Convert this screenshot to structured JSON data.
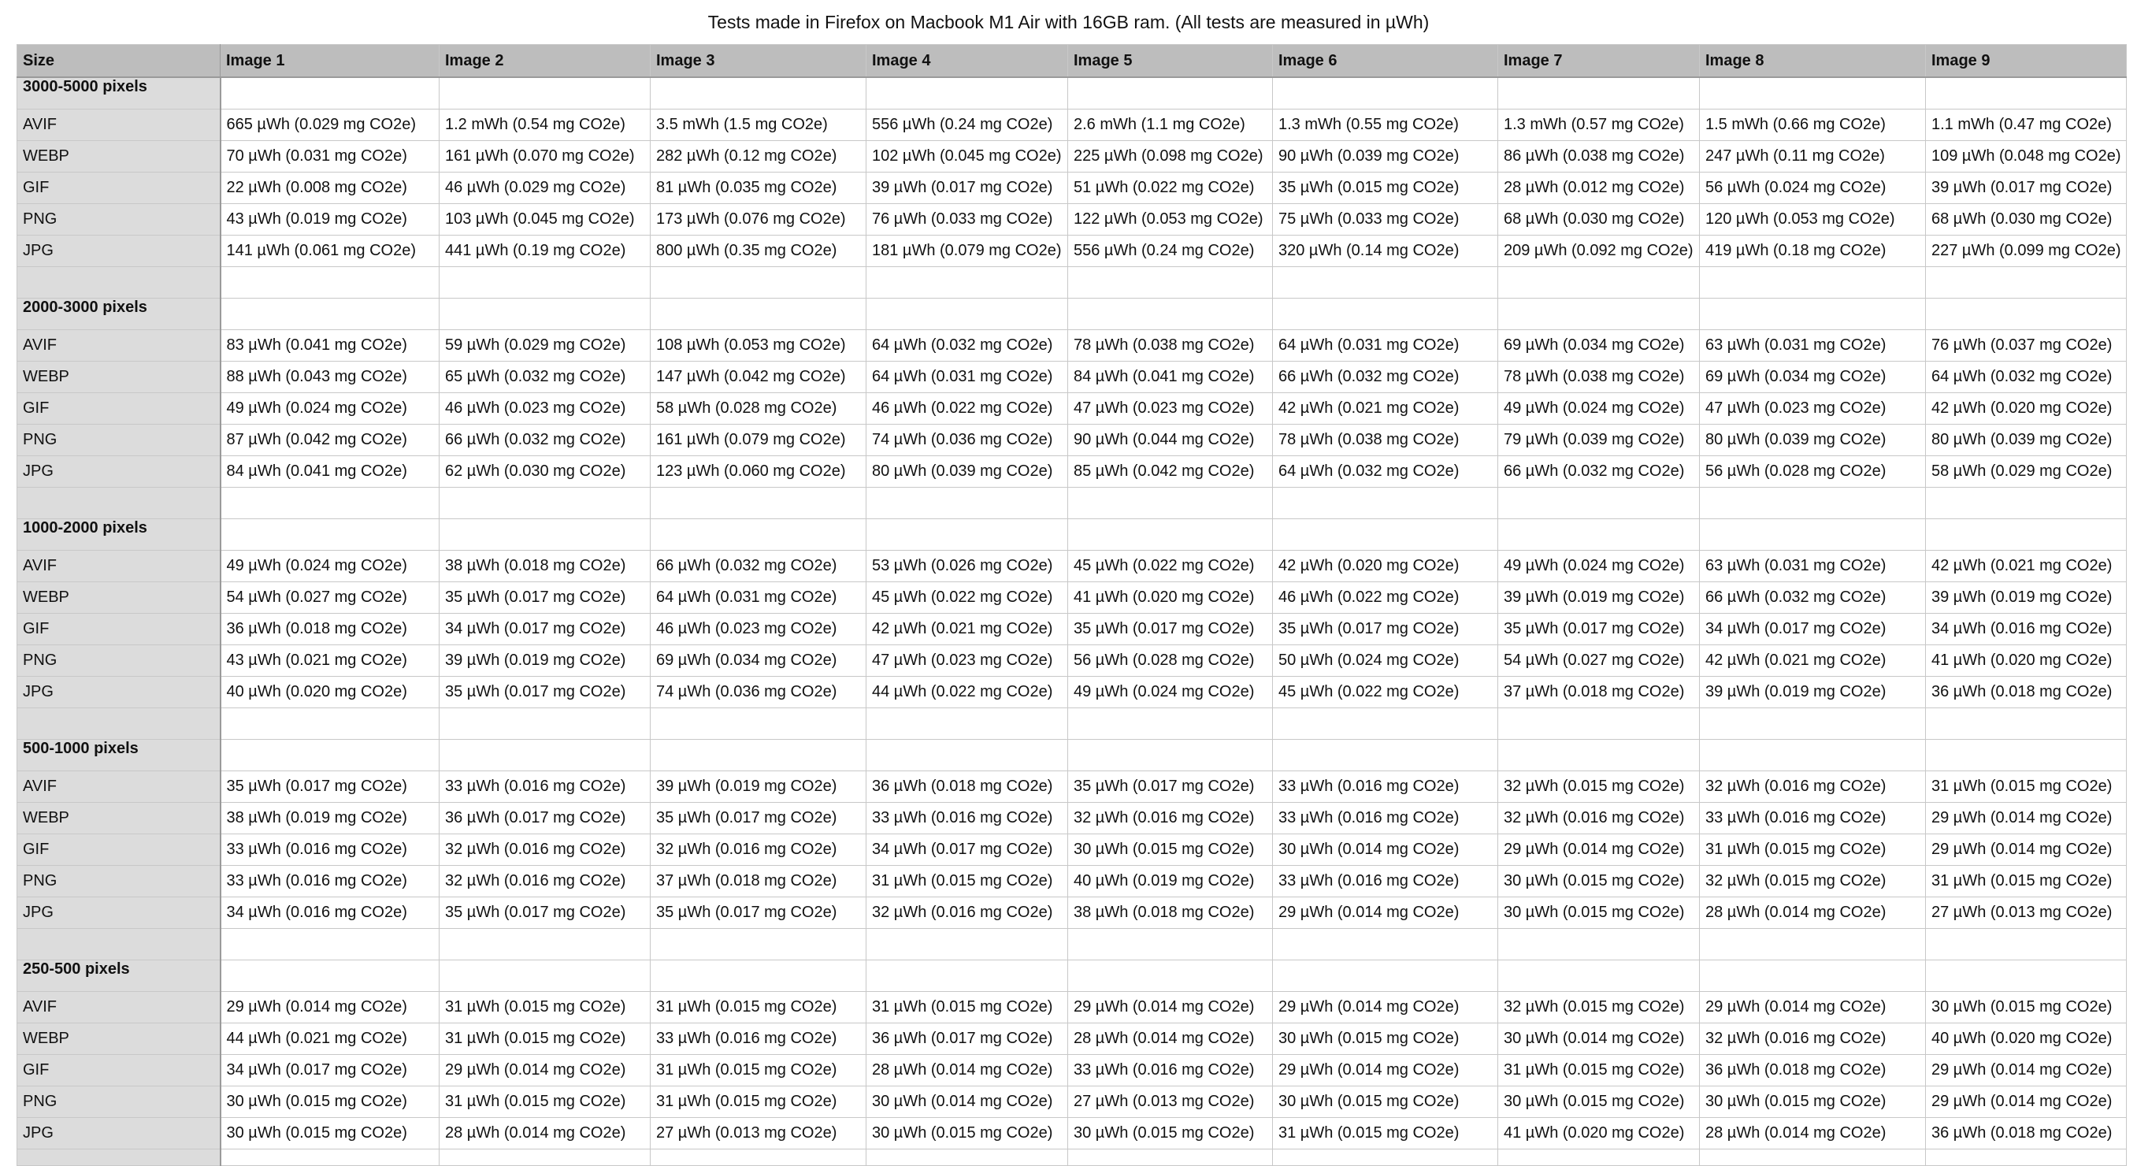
{
  "title": "Tests made in Firefox on Macbook M1 Air with 16GB ram. (All tests are measured in µWh)",
  "table": {
    "headers": [
      "Size",
      "Image 1",
      "Image 2",
      "Image 3",
      "Image 4",
      "Image 5",
      "Image 6",
      "Image 7",
      "Image 8",
      "Image 9"
    ],
    "sections": [
      {
        "name": "3000-5000 pixels",
        "rows": [
          {
            "format": "AVIF",
            "cells": [
              "665 µWh (0.029 mg CO2e)",
              "1.2 mWh (0.54 mg CO2e)",
              "3.5 mWh (1.5 mg CO2e)",
              "556 µWh (0.24 mg CO2e)",
              "2.6 mWh (1.1 mg CO2e)",
              "1.3 mWh (0.55 mg CO2e)",
              "1.3 mWh (0.57 mg CO2e)",
              "1.5 mWh (0.66 mg CO2e)",
              "1.1 mWh (0.47 mg CO2e)"
            ]
          },
          {
            "format": "WEBP",
            "cells": [
              "70 µWh (0.031 mg CO2e)",
              "161 µWh (0.070 mg CO2e)",
              "282 µWh (0.12 mg CO2e)",
              "102 µWh (0.045 mg CO2e)",
              "225 µWh (0.098 mg CO2e)",
              "90 µWh (0.039 mg CO2e)",
              "86 µWh (0.038 mg CO2e)",
              "247 µWh (0.11 mg CO2e)",
              "109 µWh (0.048 mg CO2e)"
            ]
          },
          {
            "format": "GIF",
            "cells": [
              "22 µWh (0.008 mg CO2e)",
              "46 µWh (0.029 mg CO2e)",
              "81 µWh (0.035 mg CO2e)",
              "39 µWh (0.017 mg CO2e)",
              "51 µWh (0.022 mg CO2e)",
              "35 µWh (0.015 mg CO2e)",
              "28 µWh (0.012 mg CO2e)",
              "56 µWh (0.024 mg CO2e)",
              "39 µWh (0.017 mg CO2e)"
            ]
          },
          {
            "format": "PNG",
            "cells": [
              "43 µWh (0.019 mg CO2e)",
              "103 µWh (0.045 mg CO2e)",
              "173 µWh (0.076 mg CO2e)",
              "76 µWh (0.033 mg CO2e)",
              "122 µWh (0.053 mg CO2e)",
              "75 µWh (0.033 mg CO2e)",
              "68 µWh (0.030 mg CO2e)",
              "120 µWh (0.053 mg CO2e)",
              "68 µWh (0.030 mg CO2e)"
            ]
          },
          {
            "format": "JPG",
            "cells": [
              "141 µWh (0.061 mg CO2e)",
              "441 µWh (0.19 mg CO2e)",
              "800 µWh (0.35 mg CO2e)",
              "181 µWh (0.079 mg CO2e)",
              "556 µWh (0.24 mg CO2e)",
              "320 µWh (0.14 mg CO2e)",
              "209 µWh (0.092 mg CO2e)",
              "419 µWh (0.18 mg CO2e)",
              "227 µWh (0.099 mg CO2e)"
            ]
          }
        ]
      },
      {
        "name": "2000-3000 pixels",
        "rows": [
          {
            "format": "AVIF",
            "cells": [
              "83 µWh (0.041 mg CO2e)",
              "59 µWh (0.029 mg CO2e)",
              "108 µWh (0.053 mg CO2e)",
              "64 µWh (0.032 mg CO2e)",
              "78 µWh (0.038 mg CO2e)",
              "64 µWh (0.031 mg CO2e)",
              "69 µWh (0.034 mg CO2e)",
              "63 µWh (0.031 mg CO2e)",
              "76 µWh (0.037 mg CO2e)"
            ]
          },
          {
            "format": "WEBP",
            "cells": [
              "88 µWh (0.043 mg CO2e)",
              "65 µWh (0.032 mg CO2e)",
              "147 µWh (0.042 mg CO2e)",
              "64 µWh (0.031 mg CO2e)",
              "84 µWh (0.041 mg CO2e)",
              "66 µWh (0.032 mg CO2e)",
              "78 µWh (0.038 mg CO2e)",
              "69 µWh (0.034 mg CO2e)",
              "64 µWh (0.032 mg CO2e)"
            ]
          },
          {
            "format": "GIF",
            "cells": [
              "49 µWh (0.024 mg CO2e)",
              "46 µWh (0.023 mg CO2e)",
              "58 µWh (0.028 mg CO2e)",
              "46 µWh (0.022 mg CO2e)",
              "47 µWh (0.023 mg CO2e)",
              "42 µWh (0.021 mg CO2e)",
              "49 µWh (0.024 mg CO2e)",
              "47 µWh (0.023 mg CO2e)",
              "42 µWh (0.020 mg CO2e)"
            ]
          },
          {
            "format": "PNG",
            "cells": [
              "87 µWh (0.042 mg CO2e)",
              "66 µWh (0.032 mg CO2e)",
              "161 µWh (0.079 mg CO2e)",
              "74 µWh (0.036 mg CO2e)",
              "90 µWh (0.044 mg CO2e)",
              "78 µWh (0.038 mg CO2e)",
              "79 µWh (0.039 mg CO2e)",
              "80 µWh (0.039 mg CO2e)",
              "80 µWh (0.039 mg CO2e)"
            ]
          },
          {
            "format": "JPG",
            "cells": [
              "84 µWh (0.041 mg CO2e)",
              "62 µWh (0.030 mg CO2e)",
              "123 µWh (0.060 mg CO2e)",
              "80 µWh (0.039 mg CO2e)",
              "85 µWh (0.042 mg CO2e)",
              "64 µWh (0.032 mg CO2e)",
              "66 µWh (0.032 mg CO2e)",
              "56 µWh (0.028 mg CO2e)",
              "58 µWh (0.029 mg CO2e)"
            ]
          }
        ]
      },
      {
        "name": "1000-2000 pixels",
        "rows": [
          {
            "format": "AVIF",
            "cells": [
              "49 µWh (0.024 mg CO2e)",
              "38 µWh (0.018 mg CO2e)",
              "66 µWh (0.032 mg CO2e)",
              "53 µWh (0.026 mg CO2e)",
              "45 µWh (0.022 mg CO2e)",
              "42 µWh (0.020 mg CO2e)",
              "49 µWh (0.024 mg CO2e)",
              "63 µWh (0.031 mg CO2e)",
              "42 µWh (0.021 mg CO2e)"
            ]
          },
          {
            "format": "WEBP",
            "cells": [
              "54 µWh (0.027 mg CO2e)",
              "35 µWh (0.017 mg CO2e)",
              "64 µWh (0.031 mg CO2e)",
              "45 µWh (0.022 mg CO2e)",
              "41 µWh (0.020 mg CO2e)",
              "46 µWh (0.022 mg CO2e)",
              "39 µWh (0.019 mg CO2e)",
              "66 µWh (0.032 mg CO2e)",
              "39 µWh (0.019 mg CO2e)"
            ]
          },
          {
            "format": "GIF",
            "cells": [
              "36 µWh (0.018 mg CO2e)",
              "34 µWh (0.017 mg CO2e)",
              "46 µWh (0.023 mg CO2e)",
              "42 µWh (0.021 mg CO2e)",
              "35 µWh (0.017 mg CO2e)",
              "35 µWh (0.017 mg CO2e)",
              "35 µWh (0.017 mg CO2e)",
              "34 µWh (0.017 mg CO2e)",
              "34 µWh (0.016 mg CO2e)"
            ]
          },
          {
            "format": "PNG",
            "cells": [
              "43 µWh (0.021 mg CO2e)",
              "39 µWh (0.019 mg CO2e)",
              "69 µWh (0.034 mg CO2e)",
              "47 µWh (0.023 mg CO2e)",
              "56 µWh (0.028 mg CO2e)",
              "50 µWh (0.024 mg CO2e)",
              "54 µWh (0.027 mg CO2e)",
              "42 µWh (0.021 mg CO2e)",
              "41 µWh (0.020 mg CO2e)"
            ]
          },
          {
            "format": "JPG",
            "cells": [
              "40 µWh (0.020 mg CO2e)",
              "35 µWh (0.017 mg CO2e)",
              "74 µWh (0.036 mg CO2e)",
              "44 µWh (0.022 mg CO2e)",
              "49 µWh (0.024 mg CO2e)",
              "45 µWh (0.022 mg CO2e)",
              "37 µWh (0.018 mg CO2e)",
              "39 µWh (0.019 mg CO2e)",
              "36 µWh (0.018 mg CO2e)"
            ]
          }
        ]
      },
      {
        "name": "500-1000 pixels",
        "rows": [
          {
            "format": "AVIF",
            "cells": [
              "35 µWh (0.017 mg CO2e)",
              "33 µWh (0.016 mg CO2e)",
              "39 µWh (0.019 mg CO2e)",
              "36 µWh (0.018 mg CO2e)",
              "35 µWh (0.017 mg CO2e)",
              "33 µWh (0.016 mg CO2e)",
              "32 µWh (0.015 mg CO2e)",
              "32 µWh (0.016 mg CO2e)",
              "31 µWh (0.015 mg CO2e)"
            ]
          },
          {
            "format": "WEBP",
            "cells": [
              "38 µWh (0.019 mg CO2e)",
              "36 µWh (0.017 mg CO2e)",
              "35 µWh (0.017 mg CO2e)",
              "33 µWh (0.016 mg CO2e)",
              "32 µWh (0.016 mg CO2e)",
              "33 µWh (0.016 mg CO2e)",
              "32 µWh (0.016 mg CO2e)",
              "33 µWh (0.016 mg CO2e)",
              "29 µWh (0.014 mg CO2e)"
            ]
          },
          {
            "format": "GIF",
            "cells": [
              "33 µWh (0.016 mg CO2e)",
              "32 µWh (0.016 mg CO2e)",
              "32 µWh (0.016 mg CO2e)",
              "34 µWh (0.017 mg CO2e)",
              "30 µWh (0.015 mg CO2e)",
              "30 µWh (0.014 mg CO2e)",
              "29 µWh (0.014 mg CO2e)",
              "31 µWh (0.015 mg CO2e)",
              "29 µWh (0.014 mg CO2e)"
            ]
          },
          {
            "format": "PNG",
            "cells": [
              "33 µWh (0.016 mg CO2e)",
              "32 µWh (0.016 mg CO2e)",
              "37 µWh (0.018 mg CO2e)",
              "31 µWh (0.015 mg CO2e)",
              "40 µWh (0.019 mg CO2e)",
              "33 µWh (0.016 mg CO2e)",
              "30 µWh (0.015 mg CO2e)",
              "32 µWh (0.015 mg CO2e)",
              "31 µWh (0.015 mg CO2e)"
            ]
          },
          {
            "format": "JPG",
            "cells": [
              "34 µWh (0.016 mg CO2e)",
              "35 µWh (0.017 mg CO2e)",
              "35 µWh (0.017 mg CO2e)",
              "32 µWh (0.016 mg CO2e)",
              "38 µWh (0.018 mg CO2e)",
              "29 µWh (0.014 mg CO2e)",
              "30 µWh (0.015 mg CO2e)",
              "28 µWh (0.014 mg CO2e)",
              "27 µWh (0.013 mg CO2e)"
            ]
          }
        ]
      },
      {
        "name": "250-500 pixels",
        "rows": [
          {
            "format": "AVIF",
            "cells": [
              "29 µWh (0.014 mg CO2e)",
              "31 µWh (0.015 mg CO2e)",
              "31 µWh (0.015 mg CO2e)",
              "31 µWh (0.015 mg CO2e)",
              "29 µWh (0.014 mg CO2e)",
              "29 µWh (0.014 mg CO2e)",
              "32 µWh (0.015 mg CO2e)",
              "29 µWh (0.014 mg CO2e)",
              "30 µWh (0.015 mg CO2e)"
            ]
          },
          {
            "format": "WEBP",
            "cells": [
              "44 µWh (0.021 mg CO2e)",
              "31 µWh (0.015 mg CO2e)",
              "33 µWh (0.016 mg CO2e)",
              "36 µWh (0.017 mg CO2e)",
              "28 µWh (0.014 mg CO2e)",
              "30 µWh (0.015 mg CO2e)",
              "30 µWh (0.014 mg CO2e)",
              "32 µWh (0.016 mg CO2e)",
              "40 µWh (0.020 mg CO2e)"
            ]
          },
          {
            "format": "GIF",
            "cells": [
              "34 µWh (0.017 mg CO2e)",
              "29 µWh (0.014 mg CO2e)",
              "31 µWh (0.015 mg CO2e)",
              "28 µWh (0.014 mg CO2e)",
              "33 µWh (0.016 mg CO2e)",
              "29 µWh (0.014 mg CO2e)",
              "31 µWh (0.015 mg CO2e)",
              "36 µWh (0.018 mg CO2e)",
              "29 µWh (0.014 mg CO2e)"
            ]
          },
          {
            "format": "PNG",
            "cells": [
              "30 µWh (0.015 mg CO2e)",
              "31 µWh (0.015 mg CO2e)",
              "31 µWh (0.015 mg CO2e)",
              "30 µWh (0.014 mg CO2e)",
              "27 µWh (0.013 mg CO2e)",
              "30 µWh (0.015 mg CO2e)",
              "30 µWh (0.015 mg CO2e)",
              "30 µWh (0.015 mg CO2e)",
              "29 µWh (0.014 mg CO2e)"
            ]
          },
          {
            "format": "JPG",
            "cells": [
              "30 µWh (0.015 mg CO2e)",
              "28 µWh (0.014 mg CO2e)",
              "27 µWh (0.013 mg CO2e)",
              "30 µWh (0.015 mg CO2e)",
              "30 µWh (0.015 mg CO2e)",
              "31 µWh (0.015 mg CO2e)",
              "41 µWh (0.020 mg CO2e)",
              "28 µWh (0.014 mg CO2e)",
              "36 µWh (0.018 mg CO2e)"
            ]
          }
        ]
      }
    ]
  }
}
